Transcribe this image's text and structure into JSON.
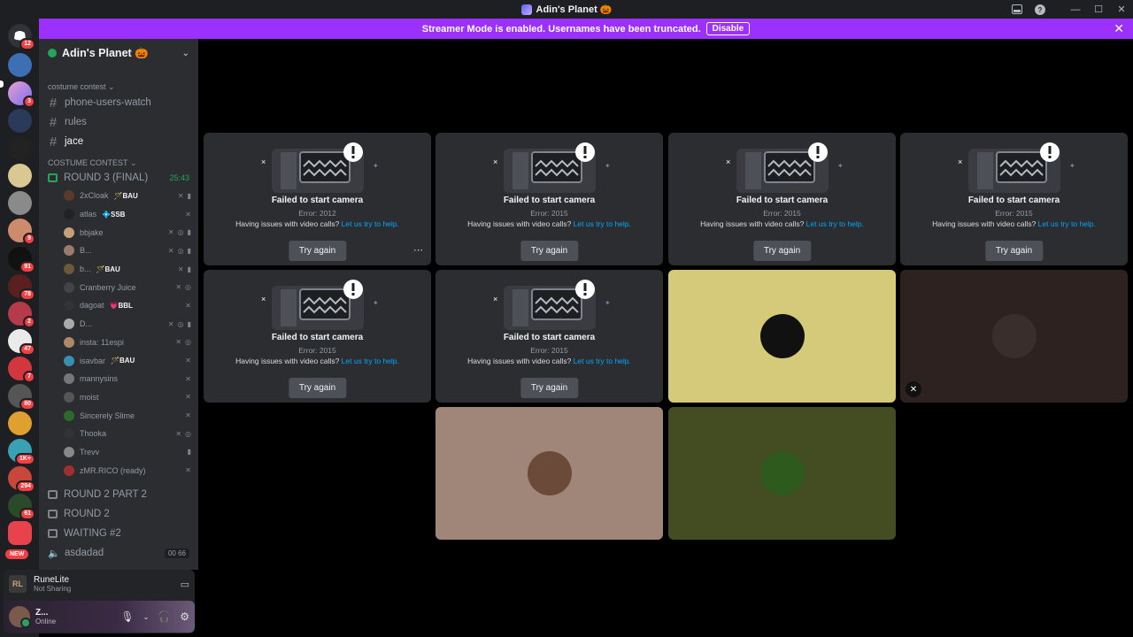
{
  "window": {
    "title": "Adin's Planet 🎃"
  },
  "banner": {
    "text": "Streamer Mode is enabled. Usernames have been truncated.",
    "disable": "Disable",
    "color": "#9b30ff"
  },
  "guild_badges": [
    "12",
    "3",
    "9",
    "91",
    "78",
    "2",
    "47",
    "7",
    "80",
    "1K+",
    "294",
    "61",
    "NEW"
  ],
  "server": {
    "name": "Adin's Planet 🎃"
  },
  "categories": {
    "first": "costume contest",
    "second": "COSTUME CONTEST"
  },
  "channels": {
    "phone": "phone-users-watch",
    "rules": "rules",
    "jace": "jace",
    "round3": "ROUND 3 (FINAL)",
    "round3_timer": "25:43",
    "round2p2": "ROUND 2 PART 2",
    "round2": "ROUND 2",
    "waiting": "WAITING #2",
    "asdadad": "asdadad",
    "asdadad_counts": "00  66"
  },
  "voice_users": [
    {
      "name": "2xCloak",
      "tag": "🪄BAU"
    },
    {
      "name": "atlas",
      "tag": "💠SSB"
    },
    {
      "name": "bbjake",
      "tag": ""
    },
    {
      "name": "B...",
      "tag": ""
    },
    {
      "name": "b...",
      "tag": "🪄BAU"
    },
    {
      "name": "Cranberry Juice",
      "tag": ""
    },
    {
      "name": "dagoat",
      "tag": "💗BBL"
    },
    {
      "name": "D...",
      "tag": ""
    },
    {
      "name": "insta: 11espi",
      "tag": ""
    },
    {
      "name": "isavbar",
      "tag": "🪄BAU"
    },
    {
      "name": "mannysins",
      "tag": ""
    },
    {
      "name": "moist",
      "tag": ""
    },
    {
      "name": "Sincerely Slime",
      "tag": ""
    },
    {
      "name": "Thooka",
      "tag": ""
    },
    {
      "name": "Trevv",
      "tag": ""
    },
    {
      "name": "zMR.RICO (ready)",
      "tag": ""
    }
  ],
  "activity": {
    "name": "RuneLite",
    "status": "Not Sharing",
    "logo": "RL"
  },
  "me": {
    "name": "Z...",
    "status": "Online"
  },
  "tiles": {
    "failed": "Failed to start camera",
    "help_prefix": "Having issues with video calls?",
    "help_link": "Let us try to help.",
    "try_again": "Try again",
    "errors": [
      "Error: 2012",
      "Error: 2015",
      "Error: 2015",
      "Error: 2015",
      "Error: 2015",
      "Error: 2015"
    ]
  },
  "tile_colors": [
    "#d5c97a",
    "#2e2220",
    "#a08579",
    "#444d21"
  ]
}
